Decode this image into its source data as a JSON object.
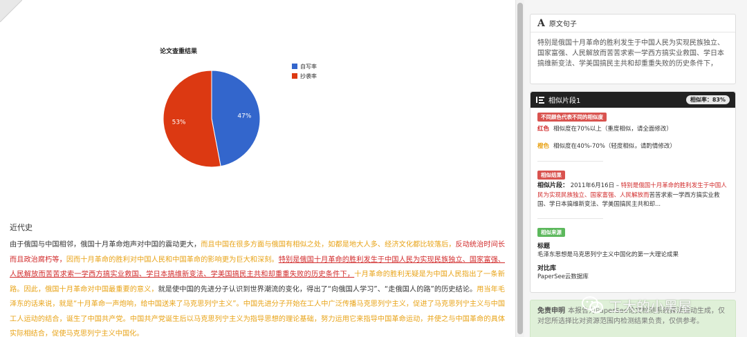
{
  "chart_data": {
    "type": "pie",
    "title": "论文查重结果",
    "series": [
      {
        "name": "自写率",
        "value": 47,
        "label": "47%",
        "color": "#3366cc"
      },
      {
        "name": "抄袭率",
        "value": 53,
        "label": "53%",
        "color": "#dc3912"
      }
    ],
    "legend_position": "right"
  },
  "report": {
    "section_heading": "近代史",
    "segments": [
      {
        "style": "normal",
        "text": "由于俄国与中国相邻，俄国十月革命炮声对中国的震动更大，"
      },
      {
        "style": "orange",
        "text": "而且中国在很多方面与俄国有相似之处，如都是地大人多、经济文化都比较落后，"
      },
      {
        "style": "red",
        "text": "反动统治时间长而且政治腐朽等，"
      },
      {
        "style": "orange",
        "text": "因而十月革命的胜利对中国人民和中国革命的影响更为巨大和深刻。"
      },
      {
        "style": "underline",
        "text": "特别是俄国十月革命的胜利发生于中国人民为实现民族独立、国家富强、人民解放而苦苦求索一学西方搞实业救国、学日本搞维新变法、学美国搞民主共和却重重失败的历史条件下，"
      },
      {
        "style": "orange",
        "text": "十月革命的胜利无疑是为中国人民指出了一条新路。"
      },
      {
        "style": "orange",
        "text": "因此，俄国十月革命对中国最重要的意义，"
      },
      {
        "style": "normal",
        "text": "就是使中国的先进分子认识到世界潮流的变化，得出了“向俄国人学习”、“走俄国人的路”的历史结论。"
      },
      {
        "style": "orange",
        "text": "用当年毛泽东的话来说，就是“十月革命一声炮响，给中国送来了马克思列宁主义”。"
      },
      {
        "style": "orange",
        "text": "中国先进分子开始在工人中广泛传播马克思列宁主义，"
      },
      {
        "style": "orange",
        "text": "促进了马克思列宁主义与中国工人运动的结合，诞生了中国共产党。"
      },
      {
        "style": "orange",
        "text": "中国共产党诞生后以马克思列宁主义为指导思想的理论基础，努力运用它来指导中国革命运动，并使之与中国革命的具体实际相结合，促使马克思列宁主义中国化。"
      }
    ]
  },
  "sentence_card": {
    "title": "原文句子",
    "text": "特别是俄国十月革命的胜利发生于中国人民为实现民族独立、国家富强、人民解放而苦苦求索一学西方搞实业救国、学日本搞维新变法、学美国搞民主共和却重重失败的历史条件下，"
  },
  "similar_card": {
    "title": "相似片段1",
    "badge": "相似率：83%",
    "legend_tag": "不同颜色代表不同的相似度",
    "legend_red_label": "红色",
    "legend_red_desc": "相似度在70%以上（重度相似，请全面修改）",
    "legend_orange_label": "橙色",
    "legend_orange_desc": "相似度在40%-70%（轻度相似，请酌情修改）",
    "result_tag": "相似结果",
    "fragment_label": "相似片段：",
    "fragment_date": "2011年6月16日",
    "fragment_dash": "–",
    "fragment_red": "特别是俄国十月革命的胜利发生于中国人民为实现民族独立、国家富强、人民解放而",
    "fragment_rest": "苦苦求索一学西方搞实业救国、学日本搞维新变法、学美国搞民主共和却...",
    "source_tag": "相似来源",
    "title_label": "标题",
    "title_value": "毛泽东思想是马克思列宁主义中国化的第一大理论成果",
    "library_label": "对比库",
    "library_value": "PaperSee云数据库"
  },
  "disclaimer": {
    "label": "免责申明",
    "text": "本报告为PaperSee论文检测系统算法自动生成，仅对您所选择比对资源范围内检测结果负责，仅供参考。"
  },
  "watermark": {
    "text": "工大的小黑屋"
  },
  "colors": {
    "self_written": "#3366cc",
    "plagiarism": "#dc3912",
    "red_mark": "#d12a2a",
    "orange_mark": "#e8a317",
    "dark_header": "#222222",
    "disclaimer_bg": "#dff0d8"
  }
}
